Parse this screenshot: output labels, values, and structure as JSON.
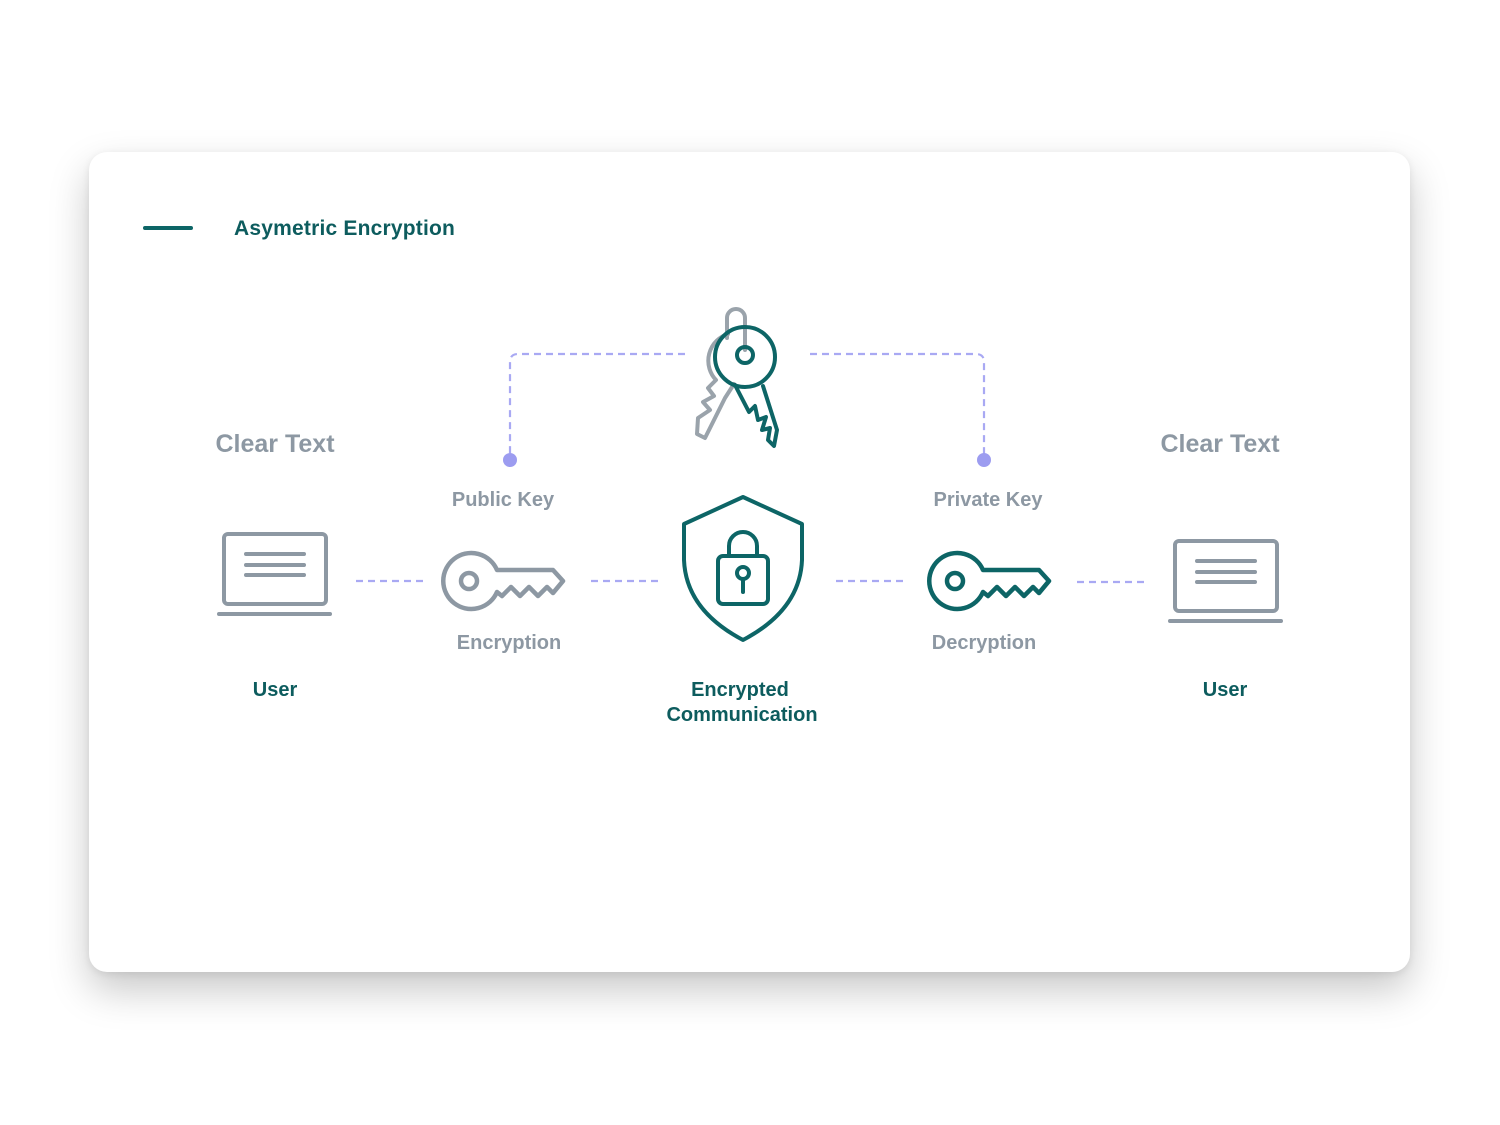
{
  "title": "Asymetric Encryption",
  "colors": {
    "accent": "#0d6566",
    "grey": "#8d98a3",
    "connector": "#a9a9f3",
    "dot": "#9c9cf0"
  },
  "nodes": {
    "left_user": {
      "caption_top": "Clear Text",
      "caption_bottom": "User",
      "icon": "laptop-icon"
    },
    "public_key": {
      "caption_top": "Public Key",
      "caption_bottom": "Encryption",
      "icon": "key-icon"
    },
    "center": {
      "caption_line1": "Encrypted",
      "caption_line2": "Communication",
      "icon": "shield-lock-icon"
    },
    "private_key": {
      "caption_top": "Private Key",
      "caption_bottom": "Decryption",
      "icon": "key-icon"
    },
    "right_user": {
      "caption_top": "Clear Text",
      "caption_bottom": "User",
      "icon": "laptop-icon"
    },
    "keyring": {
      "icon": "keyring-icon"
    }
  }
}
